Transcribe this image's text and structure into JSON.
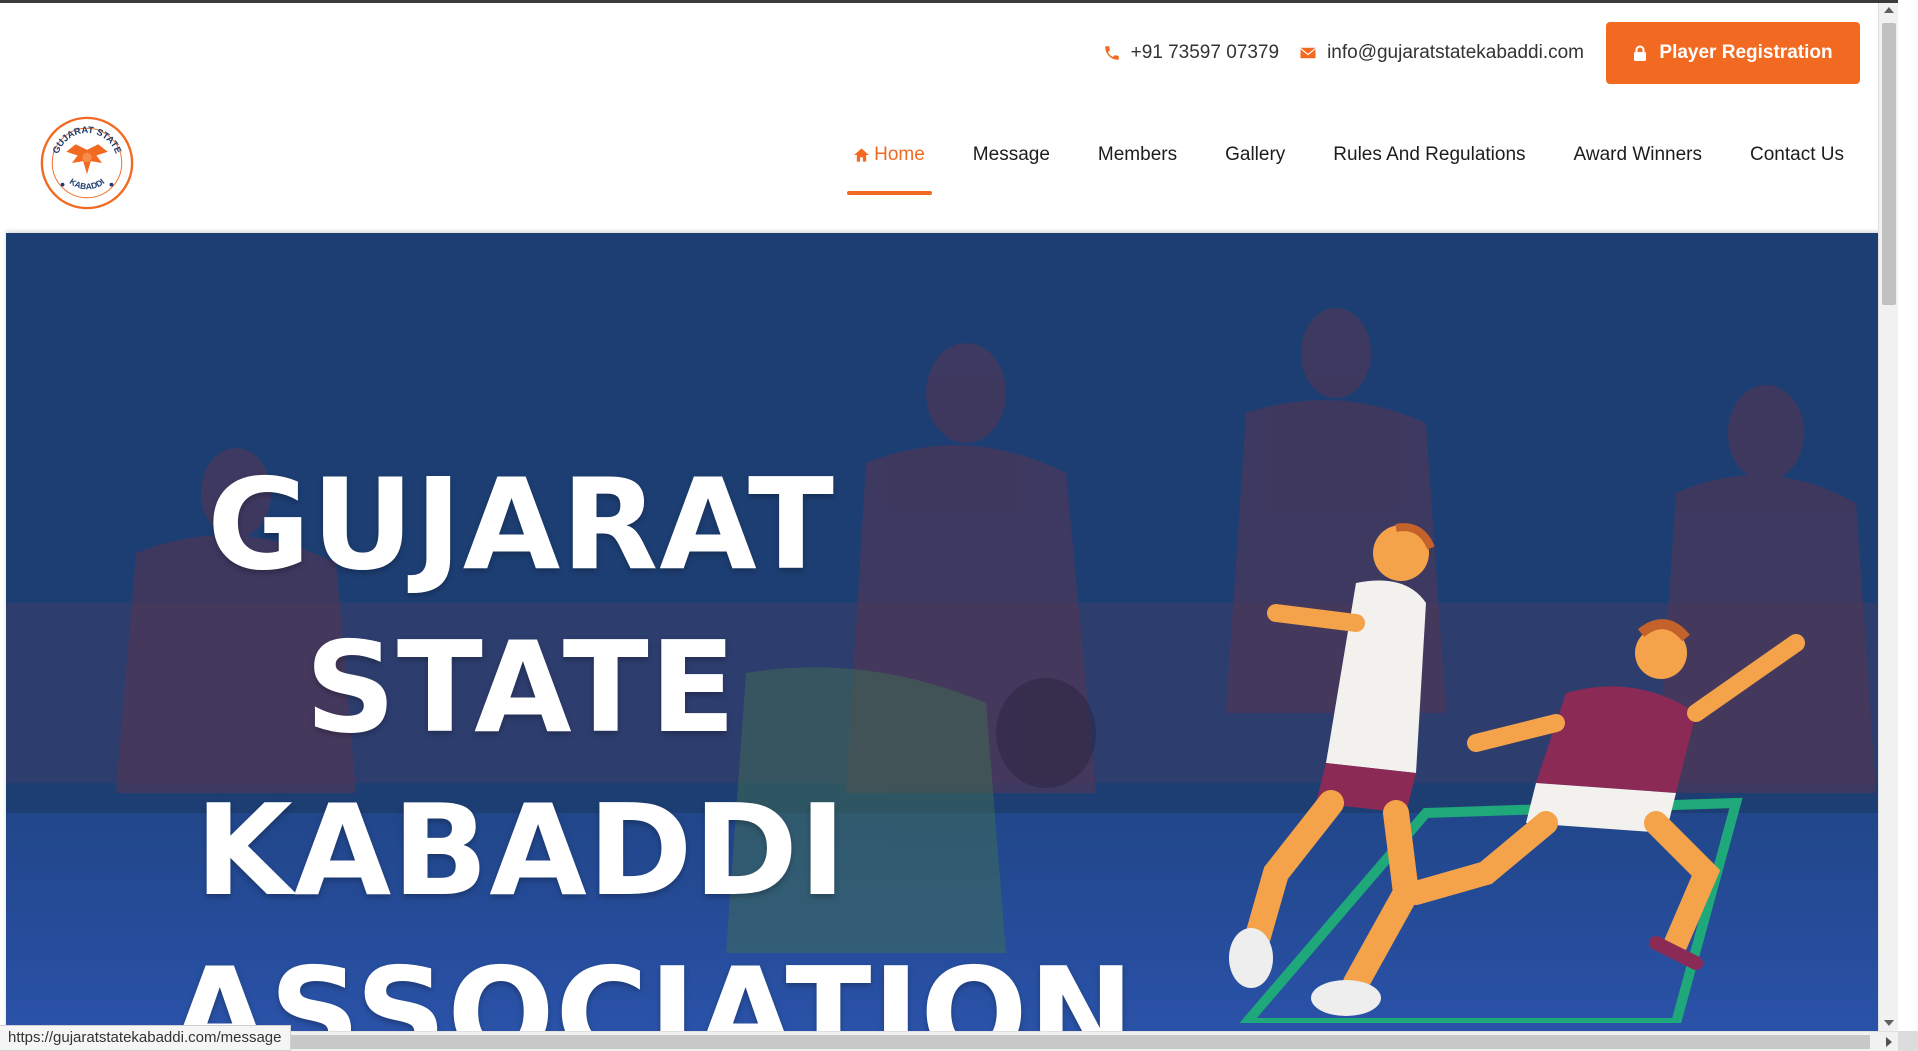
{
  "topbar": {
    "phone": "+91 73597 07379",
    "email": "info@gujaratstatekabaddi.com",
    "register_label": "Player Registration",
    "phone_icon": "phone-icon",
    "email_icon": "envelope-icon",
    "register_icon": "lock-icon"
  },
  "logo": {
    "top_text": "GUJARAT STATE",
    "bottom_text": "KABADDI"
  },
  "nav": {
    "items": [
      {
        "label": "Home",
        "active": true,
        "icon": "home-icon"
      },
      {
        "label": "Message"
      },
      {
        "label": "Members"
      },
      {
        "label": "Gallery"
      },
      {
        "label": "Rules And Regulations"
      },
      {
        "label": "Award Winners"
      },
      {
        "label": "Contact Us"
      }
    ]
  },
  "hero": {
    "line1": "GUJARAT",
    "line2": "STATE",
    "line3": "KABADDI",
    "line4": "ASSOCIATION"
  },
  "status_bar": {
    "url": "https://gujaratstatekabaddi.com/message"
  },
  "colors": {
    "accent": "#f26a21",
    "hero_overlay": "#1d3e73",
    "court_green": "#1fa87a"
  }
}
